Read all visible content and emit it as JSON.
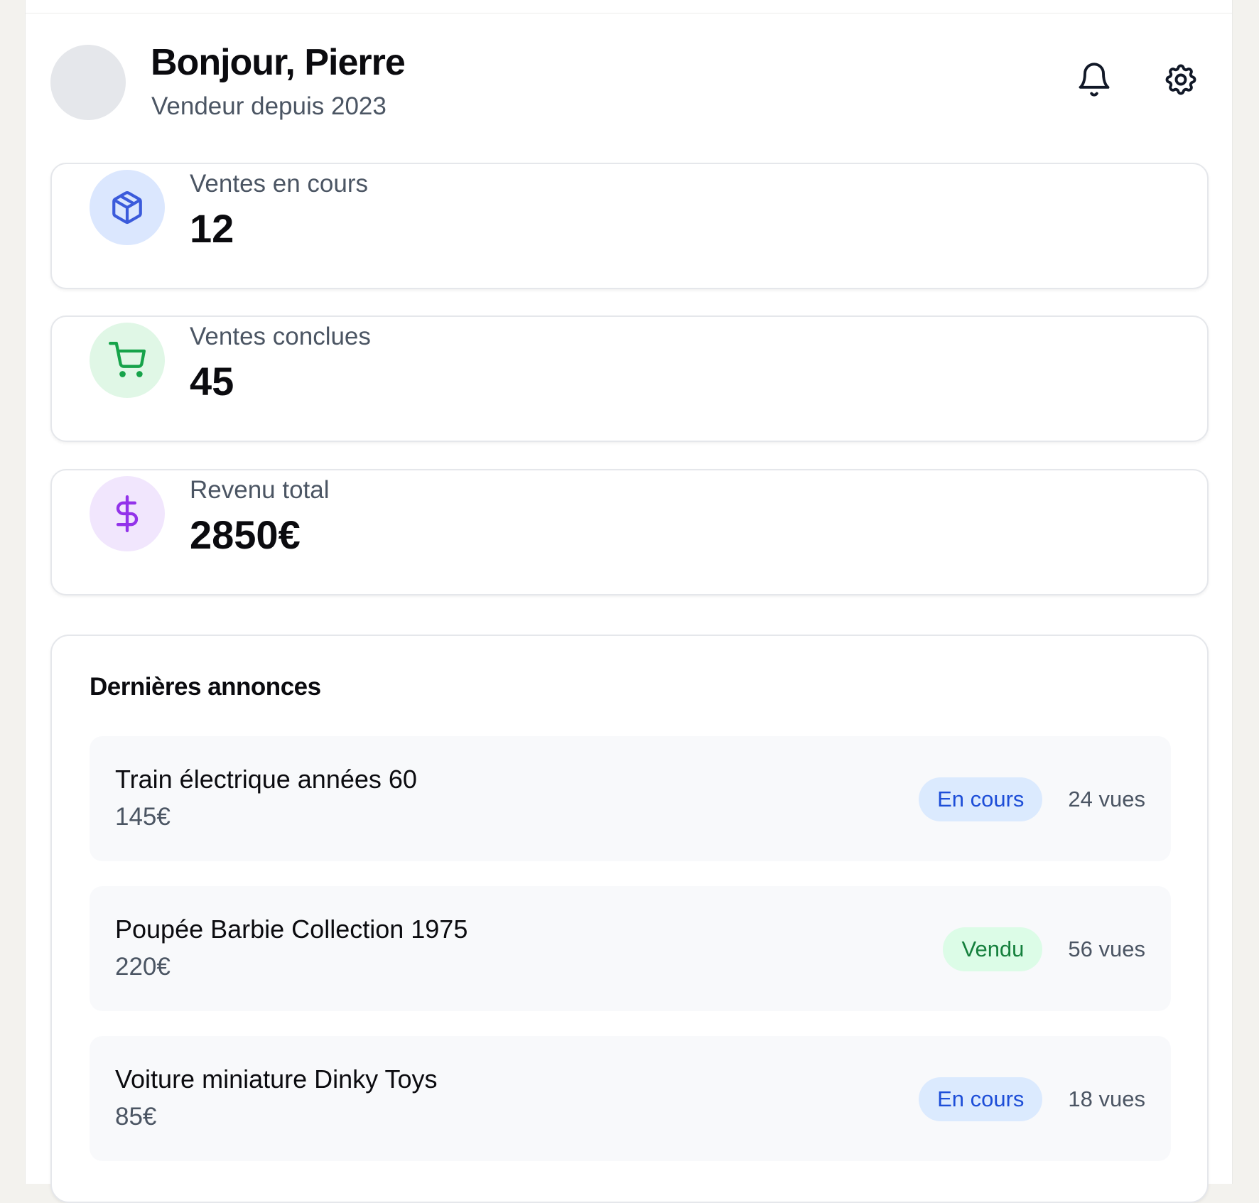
{
  "header": {
    "greeting": "Bonjour, Pierre",
    "subtitle": "Vendeur depuis 2023",
    "icons": [
      "bell-icon",
      "gear-icon"
    ]
  },
  "stats": [
    {
      "label": "Ventes en cours",
      "value": "12",
      "icon": "package-icon",
      "icon_color": "#3b5bdb",
      "bg_color": "#dbe7fe"
    },
    {
      "label": "Ventes conclues",
      "value": "45",
      "icon": "cart-icon",
      "icon_color": "#16a34a",
      "bg_color": "#e0f7e6"
    },
    {
      "label": "Revenu total",
      "value": "2850€",
      "icon": "dollar-icon",
      "icon_color": "#9333ea",
      "bg_color": "#f1e6fd"
    }
  ],
  "listings": {
    "title": "Dernières annonces",
    "items": [
      {
        "name": "Train électrique années 60",
        "price": "145€",
        "status": "En cours",
        "views": "24 vues"
      },
      {
        "name": "Poupée Barbie Collection 1975",
        "price": "220€",
        "status": "Vendu",
        "views": "56 vues"
      },
      {
        "name": "Voiture miniature Dinky Toys",
        "price": "85€",
        "status": "En cours",
        "views": "18 vues"
      }
    ]
  },
  "colors": {
    "badge_en_cours_bg": "#dbeafe",
    "badge_en_cours_text": "#1d4ed8",
    "badge_vendu_bg": "#dcfce7",
    "badge_vendu_text": "#15803d"
  }
}
